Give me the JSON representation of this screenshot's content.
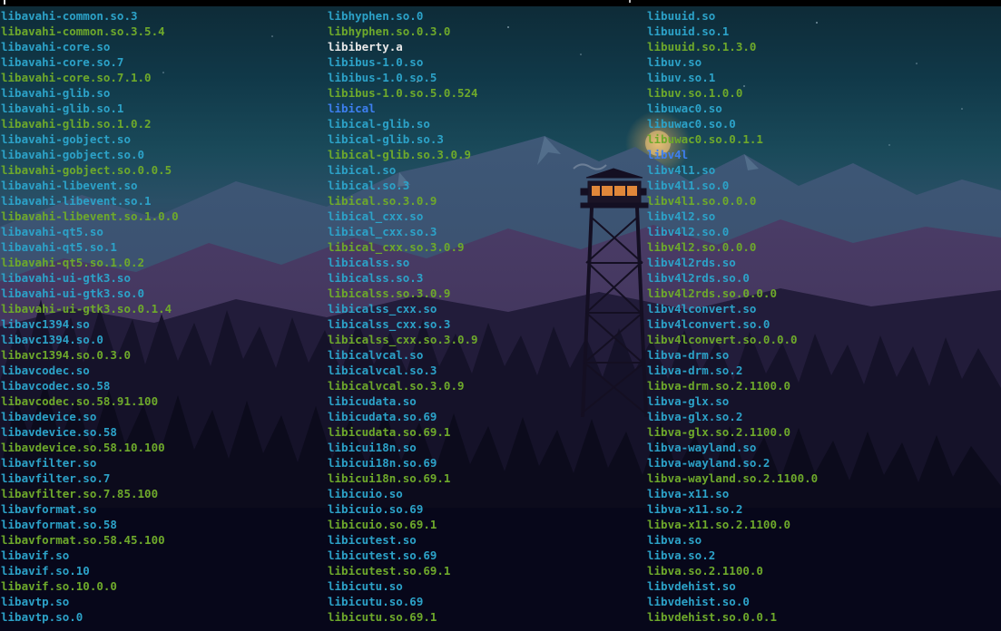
{
  "terminal": {
    "colors": {
      "symlink": "#2ca2c8",
      "executable": "#6ea92b",
      "regular": "#e8e8e8",
      "directory": "#3d7ff0"
    },
    "columns": [
      {
        "entries": [
          {
            "name": "libavahi-common.so.3",
            "kind": "link"
          },
          {
            "name": "libavahi-common.so.3.5.4",
            "kind": "file"
          },
          {
            "name": "libavahi-core.so",
            "kind": "link"
          },
          {
            "name": "libavahi-core.so.7",
            "kind": "link"
          },
          {
            "name": "libavahi-core.so.7.1.0",
            "kind": "file"
          },
          {
            "name": "libavahi-glib.so",
            "kind": "link"
          },
          {
            "name": "libavahi-glib.so.1",
            "kind": "link"
          },
          {
            "name": "libavahi-glib.so.1.0.2",
            "kind": "file"
          },
          {
            "name": "libavahi-gobject.so",
            "kind": "link"
          },
          {
            "name": "libavahi-gobject.so.0",
            "kind": "link"
          },
          {
            "name": "libavahi-gobject.so.0.0.5",
            "kind": "file"
          },
          {
            "name": "libavahi-libevent.so",
            "kind": "link"
          },
          {
            "name": "libavahi-libevent.so.1",
            "kind": "link"
          },
          {
            "name": "libavahi-libevent.so.1.0.0",
            "kind": "file"
          },
          {
            "name": "libavahi-qt5.so",
            "kind": "link"
          },
          {
            "name": "libavahi-qt5.so.1",
            "kind": "link"
          },
          {
            "name": "libavahi-qt5.so.1.0.2",
            "kind": "file"
          },
          {
            "name": "libavahi-ui-gtk3.so",
            "kind": "link"
          },
          {
            "name": "libavahi-ui-gtk3.so.0",
            "kind": "link"
          },
          {
            "name": "libavahi-ui-gtk3.so.0.1.4",
            "kind": "file"
          },
          {
            "name": "libavc1394.so",
            "kind": "link"
          },
          {
            "name": "libavc1394.so.0",
            "kind": "link"
          },
          {
            "name": "libavc1394.so.0.3.0",
            "kind": "file"
          },
          {
            "name": "libavcodec.so",
            "kind": "link"
          },
          {
            "name": "libavcodec.so.58",
            "kind": "link"
          },
          {
            "name": "libavcodec.so.58.91.100",
            "kind": "file"
          },
          {
            "name": "libavdevice.so",
            "kind": "link"
          },
          {
            "name": "libavdevice.so.58",
            "kind": "link"
          },
          {
            "name": "libavdevice.so.58.10.100",
            "kind": "file"
          },
          {
            "name": "libavfilter.so",
            "kind": "link"
          },
          {
            "name": "libavfilter.so.7",
            "kind": "link"
          },
          {
            "name": "libavfilter.so.7.85.100",
            "kind": "file"
          },
          {
            "name": "libavformat.so",
            "kind": "link"
          },
          {
            "name": "libavformat.so.58",
            "kind": "link"
          },
          {
            "name": "libavformat.so.58.45.100",
            "kind": "file"
          },
          {
            "name": "libavif.so",
            "kind": "link"
          },
          {
            "name": "libavif.so.10",
            "kind": "link"
          },
          {
            "name": "libavif.so.10.0.0",
            "kind": "file"
          },
          {
            "name": "libavtp.so",
            "kind": "link"
          },
          {
            "name": "libavtp.so.0",
            "kind": "link"
          }
        ]
      },
      {
        "entries": [
          {
            "name": "libhyphen.so.0",
            "kind": "link"
          },
          {
            "name": "libhyphen.so.0.3.0",
            "kind": "file"
          },
          {
            "name": "libiberty.a",
            "kind": "plain"
          },
          {
            "name": "libibus-1.0.so",
            "kind": "link"
          },
          {
            "name": "libibus-1.0.so.5",
            "kind": "link"
          },
          {
            "name": "libibus-1.0.so.5.0.524",
            "kind": "file"
          },
          {
            "name": "libical",
            "kind": "dir"
          },
          {
            "name": "libical-glib.so",
            "kind": "link"
          },
          {
            "name": "libical-glib.so.3",
            "kind": "link"
          },
          {
            "name": "libical-glib.so.3.0.9",
            "kind": "file"
          },
          {
            "name": "libical.so",
            "kind": "link"
          },
          {
            "name": "libical.so.3",
            "kind": "link"
          },
          {
            "name": "libical.so.3.0.9",
            "kind": "file"
          },
          {
            "name": "libical_cxx.so",
            "kind": "link"
          },
          {
            "name": "libical_cxx.so.3",
            "kind": "link"
          },
          {
            "name": "libical_cxx.so.3.0.9",
            "kind": "file"
          },
          {
            "name": "libicalss.so",
            "kind": "link"
          },
          {
            "name": "libicalss.so.3",
            "kind": "link"
          },
          {
            "name": "libicalss.so.3.0.9",
            "kind": "file"
          },
          {
            "name": "libicalss_cxx.so",
            "kind": "link"
          },
          {
            "name": "libicalss_cxx.so.3",
            "kind": "link"
          },
          {
            "name": "libicalss_cxx.so.3.0.9",
            "kind": "file"
          },
          {
            "name": "libicalvcal.so",
            "kind": "link"
          },
          {
            "name": "libicalvcal.so.3",
            "kind": "link"
          },
          {
            "name": "libicalvcal.so.3.0.9",
            "kind": "file"
          },
          {
            "name": "libicudata.so",
            "kind": "link"
          },
          {
            "name": "libicudata.so.69",
            "kind": "link"
          },
          {
            "name": "libicudata.so.69.1",
            "kind": "file"
          },
          {
            "name": "libicui18n.so",
            "kind": "link"
          },
          {
            "name": "libicui18n.so.69",
            "kind": "link"
          },
          {
            "name": "libicui18n.so.69.1",
            "kind": "file"
          },
          {
            "name": "libicuio.so",
            "kind": "link"
          },
          {
            "name": "libicuio.so.69",
            "kind": "link"
          },
          {
            "name": "libicuio.so.69.1",
            "kind": "file"
          },
          {
            "name": "libicutest.so",
            "kind": "link"
          },
          {
            "name": "libicutest.so.69",
            "kind": "link"
          },
          {
            "name": "libicutest.so.69.1",
            "kind": "file"
          },
          {
            "name": "libicutu.so",
            "kind": "link"
          },
          {
            "name": "libicutu.so.69",
            "kind": "link"
          },
          {
            "name": "libicutu.so.69.1",
            "kind": "file"
          }
        ]
      },
      {
        "entries": [
          {
            "name": "libuuid.so",
            "kind": "link"
          },
          {
            "name": "libuuid.so.1",
            "kind": "link"
          },
          {
            "name": "libuuid.so.1.3.0",
            "kind": "file"
          },
          {
            "name": "libuv.so",
            "kind": "link"
          },
          {
            "name": "libuv.so.1",
            "kind": "link"
          },
          {
            "name": "libuv.so.1.0.0",
            "kind": "file"
          },
          {
            "name": "libuwac0.so",
            "kind": "link"
          },
          {
            "name": "libuwac0.so.0",
            "kind": "link"
          },
          {
            "name": "libuwac0.so.0.1.1",
            "kind": "file"
          },
          {
            "name": "libv4l",
            "kind": "dir"
          },
          {
            "name": "libv4l1.so",
            "kind": "link"
          },
          {
            "name": "libv4l1.so.0",
            "kind": "link"
          },
          {
            "name": "libv4l1.so.0.0.0",
            "kind": "file"
          },
          {
            "name": "libv4l2.so",
            "kind": "link"
          },
          {
            "name": "libv4l2.so.0",
            "kind": "link"
          },
          {
            "name": "libv4l2.so.0.0.0",
            "kind": "file"
          },
          {
            "name": "libv4l2rds.so",
            "kind": "link"
          },
          {
            "name": "libv4l2rds.so.0",
            "kind": "link"
          },
          {
            "name": "libv4l2rds.so.0.0.0",
            "kind": "file"
          },
          {
            "name": "libv4lconvert.so",
            "kind": "link"
          },
          {
            "name": "libv4lconvert.so.0",
            "kind": "link"
          },
          {
            "name": "libv4lconvert.so.0.0.0",
            "kind": "file"
          },
          {
            "name": "libva-drm.so",
            "kind": "link"
          },
          {
            "name": "libva-drm.so.2",
            "kind": "link"
          },
          {
            "name": "libva-drm.so.2.1100.0",
            "kind": "file"
          },
          {
            "name": "libva-glx.so",
            "kind": "link"
          },
          {
            "name": "libva-glx.so.2",
            "kind": "link"
          },
          {
            "name": "libva-glx.so.2.1100.0",
            "kind": "file"
          },
          {
            "name": "libva-wayland.so",
            "kind": "link"
          },
          {
            "name": "libva-wayland.so.2",
            "kind": "link"
          },
          {
            "name": "libva-wayland.so.2.1100.0",
            "kind": "file"
          },
          {
            "name": "libva-x11.so",
            "kind": "link"
          },
          {
            "name": "libva-x11.so.2",
            "kind": "link"
          },
          {
            "name": "libva-x11.so.2.1100.0",
            "kind": "file"
          },
          {
            "name": "libva.so",
            "kind": "link"
          },
          {
            "name": "libva.so.2",
            "kind": "link"
          },
          {
            "name": "libva.so.2.1100.0",
            "kind": "file"
          },
          {
            "name": "libvdehist.so",
            "kind": "link"
          },
          {
            "name": "libvdehist.so.0",
            "kind": "link"
          },
          {
            "name": "libvdehist.so.0.0.1",
            "kind": "file"
          }
        ]
      }
    ]
  }
}
